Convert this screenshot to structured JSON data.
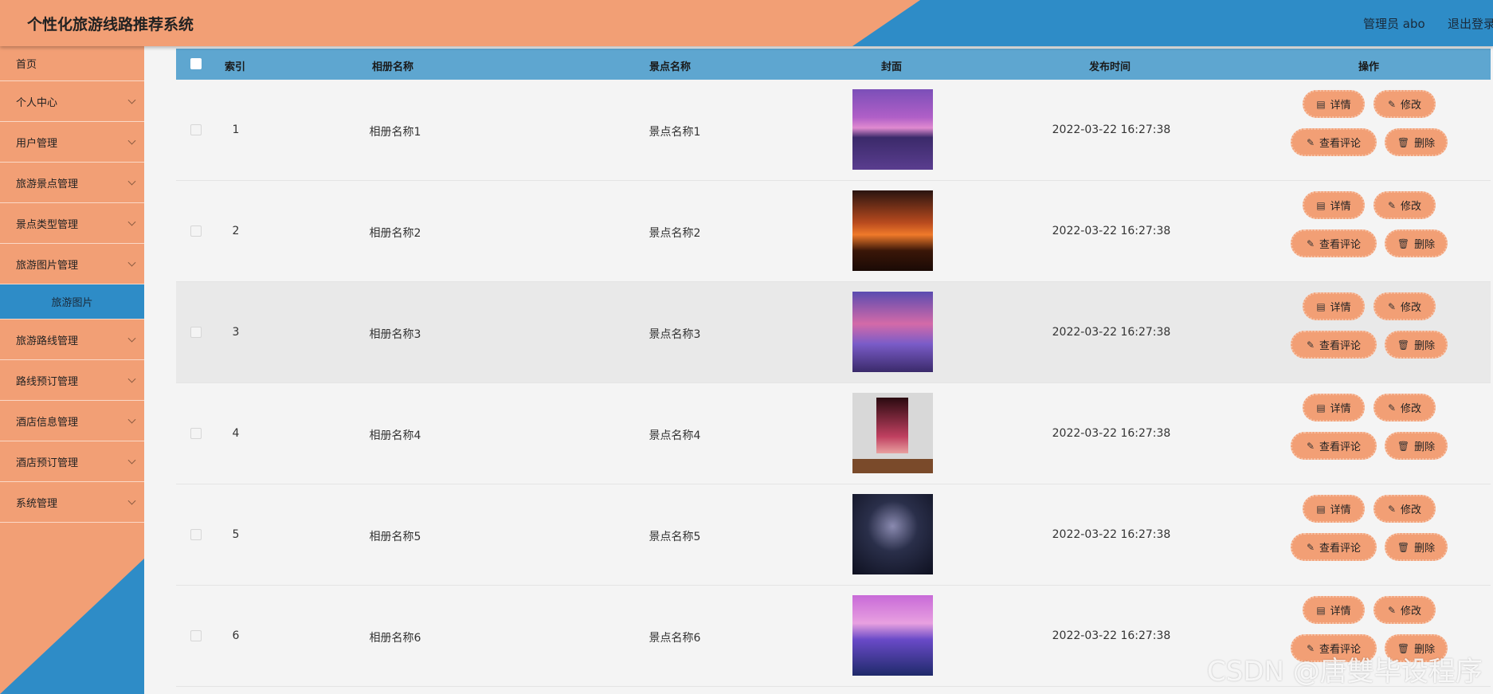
{
  "header": {
    "title": "个性化旅游线路推荐系统",
    "user_label": "管理员 abo",
    "logout_label": "退出登录"
  },
  "sidebar": {
    "items": [
      {
        "label": "首页",
        "has_arrow": false
      },
      {
        "label": "个人中心",
        "has_arrow": true
      },
      {
        "label": "用户管理",
        "has_arrow": true
      },
      {
        "label": "旅游景点管理",
        "has_arrow": true
      },
      {
        "label": "景点类型管理",
        "has_arrow": true
      },
      {
        "label": "旅游图片管理",
        "has_arrow": true
      },
      {
        "label": "旅游路线管理",
        "has_arrow": true
      },
      {
        "label": "路线预订管理",
        "has_arrow": true
      },
      {
        "label": "酒店信息管理",
        "has_arrow": true
      },
      {
        "label": "酒店预订管理",
        "has_arrow": true
      },
      {
        "label": "系统管理",
        "has_arrow": true
      }
    ],
    "active_sub_item": "旅游图片"
  },
  "table": {
    "headers": [
      "索引",
      "相册名称",
      "景点名称",
      "封面",
      "发布时间",
      "操作"
    ],
    "rows": [
      {
        "index": "1",
        "album": "相册名称1",
        "spot": "景点名称1",
        "time": "2022-03-22 16:27:38"
      },
      {
        "index": "2",
        "album": "相册名称2",
        "spot": "景点名称2",
        "time": "2022-03-22 16:27:38"
      },
      {
        "index": "3",
        "album": "相册名称3",
        "spot": "景点名称3",
        "time": "2022-03-22 16:27:38"
      },
      {
        "index": "4",
        "album": "相册名称4",
        "spot": "景点名称4",
        "time": "2022-03-22 16:27:38"
      },
      {
        "index": "5",
        "album": "相册名称5",
        "spot": "景点名称5",
        "time": "2022-03-22 16:27:38"
      },
      {
        "index": "6",
        "album": "相册名称6",
        "spot": "景点名称6",
        "time": "2022-03-22 16:27:38"
      }
    ],
    "actions": {
      "detail": "详情",
      "edit": "修改",
      "comments": "查看评论",
      "delete": "删除"
    }
  },
  "watermark": "CSDN @唐雙毕设程序",
  "colors": {
    "orange": "#f29f75",
    "blue": "#2e8cc7",
    "table_header": "#5ea6d0"
  }
}
